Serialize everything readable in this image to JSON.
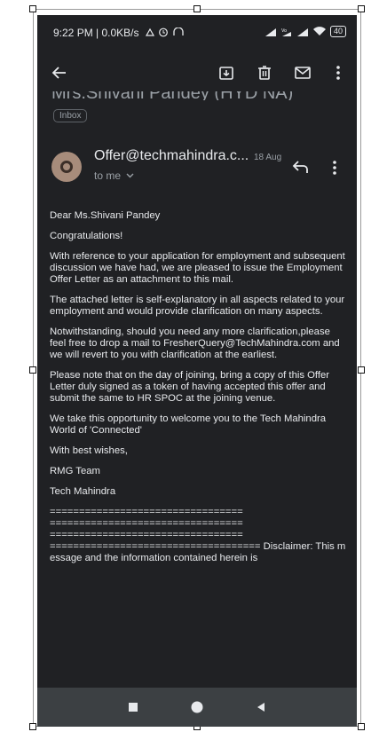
{
  "status_bar": {
    "time_and_speed": "9:22 PM | 0.0KB/s",
    "battery": "40"
  },
  "app_bar": {
    "back_icon": "arrow-left-icon",
    "archive_icon": "archive-icon",
    "delete_icon": "trash-icon",
    "mark_unread_icon": "envelope-icon",
    "more_icon": "more-vertical-icon"
  },
  "email": {
    "subject": "Mrs.Shivani Pandey (HYD NA)",
    "label_chip": "Inbox",
    "sender": "Offer@techmahindra.c...",
    "date": "18 Aug",
    "recipient": "to me",
    "body": {
      "greeting": "Dear Ms.Shivani Pandey",
      "congrats": "Congratulations!",
      "p1": "With reference to your application for employment and subsequent discussion we have had, we are pleased to issue the Employment Offer Letter as an attachment to this mail.",
      "p2": "The attached letter is self-explanatory in all aspects related to your employment and would provide clarification on many aspects.",
      "p3": "Notwithstanding, should you need any more clarification,please feel free to drop a mail to FresherQuery@TechMahindra.com and we will revert to you with clarification at the earliest.",
      "p4": "Please note that on the day of joining, bring a copy of this Offer Letter duly signed as a token of having accepted this offer and submit the same to HR SPOC at the joining venue.",
      "p5": "We take this opportunity to welcome you to the Tech Mahindra World of 'Connected'",
      "closing": "With best wishes,",
      "team": "RMG Team",
      "company": "Tech Mahindra",
      "separator": "=================================\n=================================\n=================================\n==================================== Disclaimer: This message and the information contained herein is"
    }
  },
  "nav_bar": {
    "recents_icon": "square-icon",
    "home_icon": "circle-icon",
    "back_icon": "triangle-back-icon"
  },
  "colors": {
    "background": "#202124",
    "text": "#e8eaed",
    "muted": "#9aa0a6",
    "avatar": "#a78c7b",
    "nav_bar": "#3c4043"
  }
}
